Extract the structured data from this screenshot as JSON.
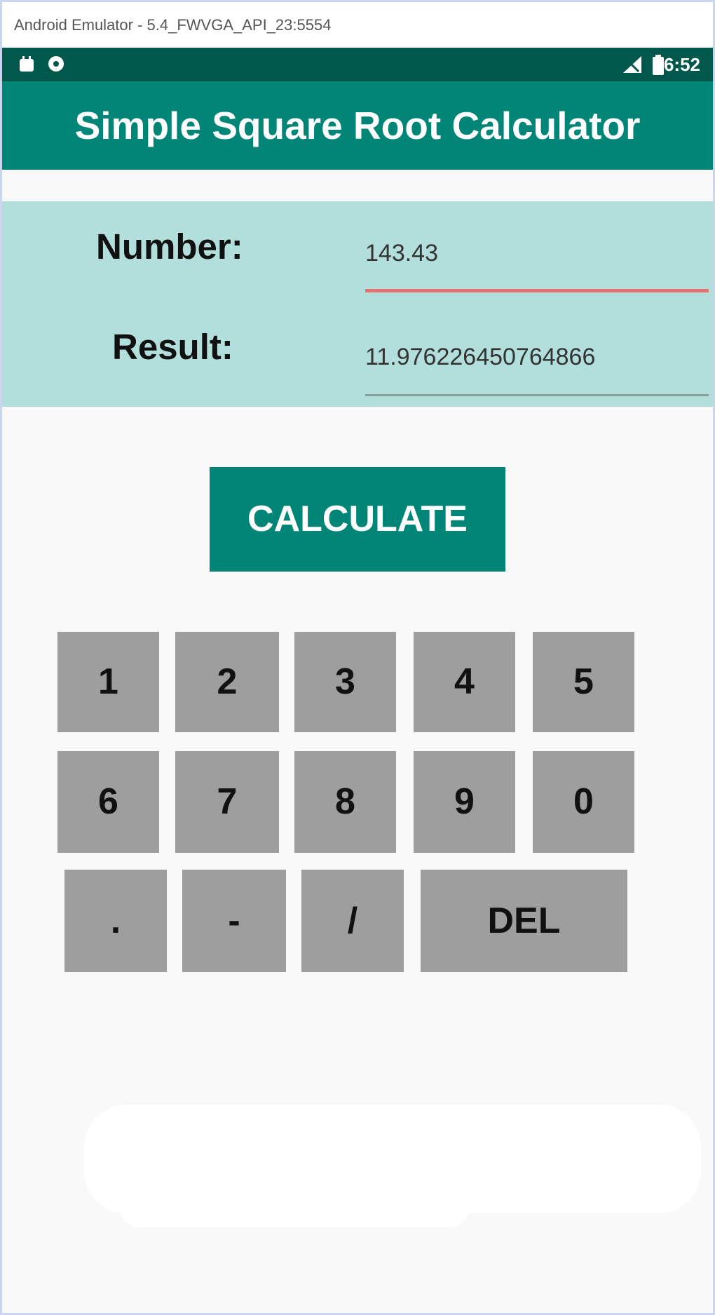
{
  "window": {
    "title": "Android Emulator - 5.4_FWVGA_API_23:5554"
  },
  "status_bar": {
    "time": "6:52",
    "left_icons": [
      "android-notification-icon",
      "circle-notification-icon"
    ],
    "right_icons": [
      "signal-icon",
      "battery-icon"
    ]
  },
  "app_bar": {
    "title": "Simple Square Root Calculator"
  },
  "form": {
    "number_label": "Number:",
    "number_value": "143.43",
    "result_label": "Result:",
    "result_value": "11.976226450764866"
  },
  "calculate_button": {
    "label": "CALCULATE"
  },
  "keypad": {
    "row1": [
      "1",
      "2",
      "3",
      "4",
      "5"
    ],
    "row2": [
      "6",
      "7",
      "8",
      "9",
      "0"
    ],
    "row3": [
      ".",
      "-",
      "/",
      "DEL"
    ]
  },
  "colors": {
    "primary": "#008577",
    "primary_dark": "#00574b",
    "panel": "#b2dfdb",
    "key": "#9e9e9e",
    "focus_underline": "#e57373"
  }
}
